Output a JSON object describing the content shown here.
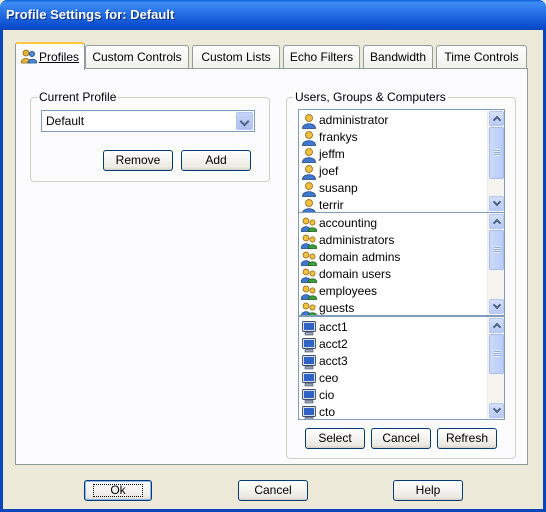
{
  "window": {
    "title": "Profile Settings for: Default"
  },
  "tabs": [
    {
      "label": "Profiles",
      "active": true
    },
    {
      "label": "Custom Controls"
    },
    {
      "label": "Custom Lists"
    },
    {
      "label": "Echo Filters"
    },
    {
      "label": "Bandwidth"
    },
    {
      "label": "Time Controls"
    }
  ],
  "current_profile": {
    "group_label": "Current Profile",
    "selected": "Default",
    "remove_label": "Remove",
    "add_label": "Add"
  },
  "ugc": {
    "group_label": "Users, Groups & Computers",
    "users": [
      "administrator",
      "frankys",
      "jeffm",
      "joef",
      "susanp",
      "terrir"
    ],
    "groups": [
      "accounting",
      "administrators",
      "domain admins",
      "domain users",
      "employees",
      "guests"
    ],
    "computers": [
      "acct1",
      "acct2",
      "acct3",
      "ceo",
      "cio",
      "cto"
    ],
    "select_label": "Select",
    "cancel_label": "Cancel",
    "refresh_label": "Refresh"
  },
  "footer": {
    "ok_label": "Ok",
    "cancel_label": "Cancel",
    "help_label": "Help"
  },
  "colors": {
    "title_bar": "#0a46bb",
    "dialog_bg": "#ece9d8",
    "panel_bg": "#fcfcfe",
    "active_tab_accent": "#ffc83c"
  }
}
